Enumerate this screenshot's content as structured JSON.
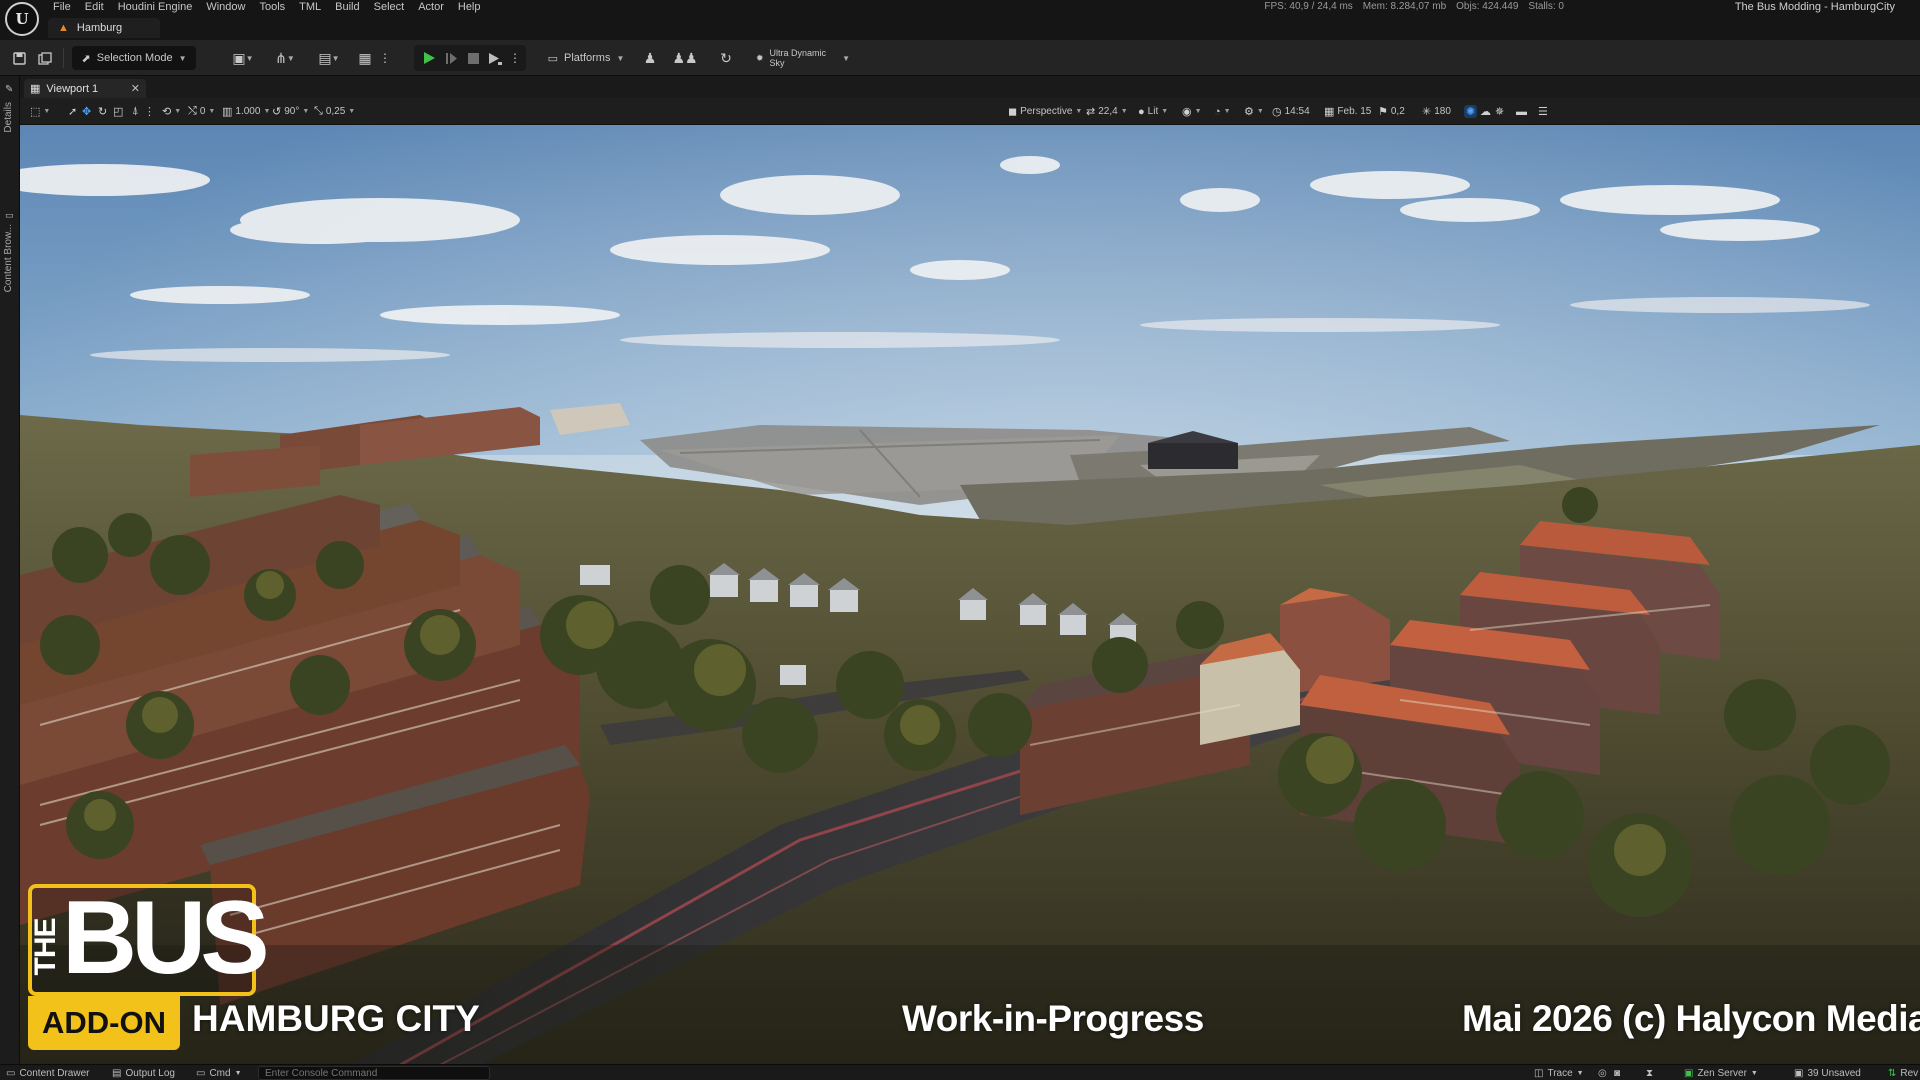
{
  "menu": [
    "File",
    "Edit",
    "Houdini Engine",
    "Window",
    "Tools",
    "TML",
    "Build",
    "Select",
    "Actor",
    "Help"
  ],
  "level_tab": "Hamburg",
  "stats": {
    "fps": "FPS: 40,9",
    "ms": "/ 24,4 ms",
    "mem": "Mem: 8.284,07 mb",
    "objs": "Objs: 424.449",
    "stalls": "Stalls: 0"
  },
  "project_title": "The Bus Modding - HamburgCity",
  "toolbar": {
    "selection_mode": "Selection Mode",
    "platforms": "Platforms",
    "sky": "Ultra Dynamic Sky"
  },
  "left_strip": {
    "details": "Details",
    "content_browser": "Content Brow..."
  },
  "viewport_tab": "Viewport 1",
  "viewport_toolbar": {
    "translate_snap": "0",
    "scale_value": "1.000",
    "rotate_snap": "90°",
    "scale_snap": "0,25",
    "view_mode": "Perspective",
    "fov": "22,4",
    "lit": "Lit",
    "time": "14:54",
    "date": "Feb. 15",
    "wind": "0,2",
    "sun": "180"
  },
  "overlay": {
    "logo_the": "THE",
    "logo_bus": "BUS",
    "addon": "ADD-ON",
    "city": "HAMBURG CITY",
    "status": "Work-in-Progress",
    "copyright": "Mai 2026  (c) Halycon Media"
  },
  "statusbar": {
    "content_drawer": "Content Drawer",
    "output_log": "Output Log",
    "cmd": "Cmd",
    "console_placeholder": "Enter Console Command",
    "trace": "Trace",
    "zen_server": "Zen Server",
    "unsaved": "39 Unsaved",
    "revision": "Rev"
  },
  "colors": {
    "accent_yellow": "#f2c21b",
    "play_green": "#3ec24a",
    "level_orange": "#e58a2c"
  }
}
